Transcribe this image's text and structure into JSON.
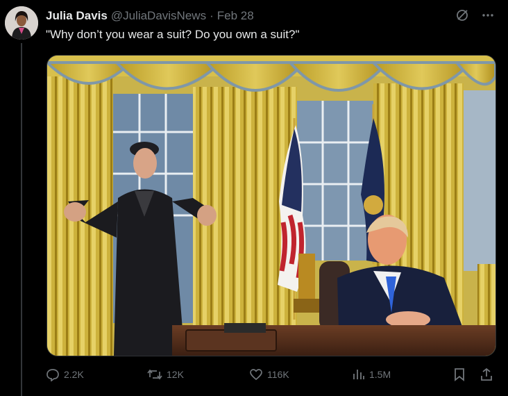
{
  "tweet": {
    "author": {
      "display_name": "Julia Davis",
      "handle": "@JuliaDavisNews",
      "separator": "·",
      "date": "Feb 28"
    },
    "text": "\"Why don’t you wear a suit? Do you own a suit?\"",
    "media": {
      "kind": "photo",
      "scene": "oval-office"
    },
    "stats": {
      "replies": "2.2K",
      "reposts": "12K",
      "likes": "116K",
      "views": "1.5M"
    }
  },
  "icons": {
    "top": [
      "grok-icon",
      "more-icon"
    ],
    "actions": [
      "reply-icon",
      "repost-icon",
      "like-icon",
      "views-icon",
      "bookmark-icon",
      "share-icon"
    ]
  },
  "colors": {
    "background": "#000000",
    "text_primary": "#e7e9ea",
    "text_secondary": "#71767b",
    "divider": "#333639"
  }
}
